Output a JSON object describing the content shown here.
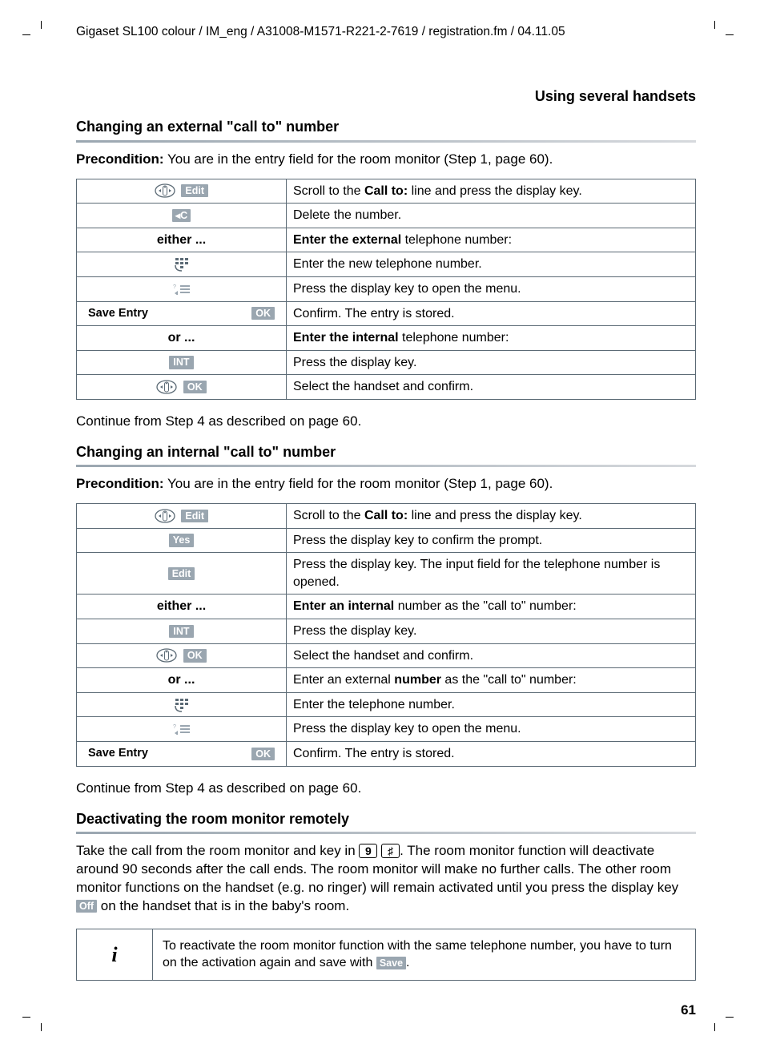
{
  "header": "Gigaset SL100 colour / IM_eng / A31008-M1571-R221-2-7619 / registration.fm / 04.11.05",
  "page_title": "Using several handsets",
  "page_number": "61",
  "section1": {
    "heading": "Changing an external \"call to\" number",
    "pre_label": "Precondition:",
    "pre_text": " You are in the entry field for the room monitor (Step 1, page 60).",
    "rows": [
      {
        "icon": "nav",
        "key": "Edit",
        "txt_pre": "Scroll to the ",
        "txt_b": "Call to:",
        "txt_post": " line and press the display key."
      },
      {
        "icon": "",
        "key": "◂C",
        "txt": "Delete the number."
      },
      {
        "icon": "",
        "key": "",
        "label": "either ...",
        "txt_b": "Enter the external",
        "txt_post": " telephone number:"
      },
      {
        "icon": "keypad",
        "key": "",
        "txt": "Enter the new telephone number."
      },
      {
        "icon": "menu",
        "key": "",
        "txt": "Press the display key to open the menu."
      },
      {
        "icon": "",
        "key": "OK",
        "left_label": "Save Entry",
        "txt": "Confirm. The entry is stored."
      },
      {
        "icon": "",
        "key": "",
        "label": "or ...",
        "txt_b": "Enter the internal",
        "txt_post": " telephone number:"
      },
      {
        "icon": "",
        "key": "INT",
        "txt": "Press the display key."
      },
      {
        "icon": "nav",
        "key": "OK",
        "txt": "Select the handset and confirm."
      }
    ],
    "continue": "Continue from Step 4 as described on page 60."
  },
  "section2": {
    "heading": "Changing an internal \"call to\" number",
    "pre_label": "Precondition:",
    "pre_text": " You are in the entry field for the room monitor (Step 1, page 60).",
    "rows": [
      {
        "icon": "nav",
        "key": "Edit",
        "txt_pre": "Scroll to the ",
        "txt_b": "Call to:",
        "txt_post": " line and press the display key."
      },
      {
        "icon": "",
        "key": "Yes",
        "txt": "Press the display key to confirm the prompt."
      },
      {
        "icon": "",
        "key": "Edit",
        "txt": "Press the display key. The input field for the telephone number is opened."
      },
      {
        "icon": "",
        "key": "",
        "label": "either ...",
        "txt_b": "Enter an internal",
        "txt_post": " number as the \"call to\" number:"
      },
      {
        "icon": "",
        "key": "INT",
        "txt": "Press the display key."
      },
      {
        "icon": "nav",
        "key": "OK",
        "txt": "Select the handset and confirm."
      },
      {
        "icon": "",
        "key": "",
        "label": "or ...",
        "txt_pre": "Enter an external ",
        "txt_b": "number",
        "txt_post": " as the \"call to\" number:"
      },
      {
        "icon": "keypad",
        "key": "",
        "txt": "Enter the telephone number."
      },
      {
        "icon": "menu",
        "key": "",
        "txt": "Press the display key to open the menu."
      },
      {
        "icon": "",
        "key": "OK",
        "left_label": "Save Entry",
        "txt": "Confirm. The entry is stored."
      }
    ],
    "continue": "Continue from Step 4 as described on page 60."
  },
  "section3": {
    "heading": "Deactivating the room monitor remotely",
    "para_pre": "Take the call from the room monitor and key in ",
    "k1": "9",
    "k2": "♯",
    "para_mid": ". The room monitor function will deactivate around 90 seconds after the call ends. The room monitor will make no further calls. The other room monitor functions on the handset (e.g. no ringer) will remain activated until you press the display key ",
    "off_key": "Off",
    "para_post": " on the handset that is in the baby's room.",
    "info_pre": "To reactivate the room monitor function with the same telephone number, you have to turn on the activation again and save with ",
    "save_key": "Save",
    "info_post": "."
  }
}
